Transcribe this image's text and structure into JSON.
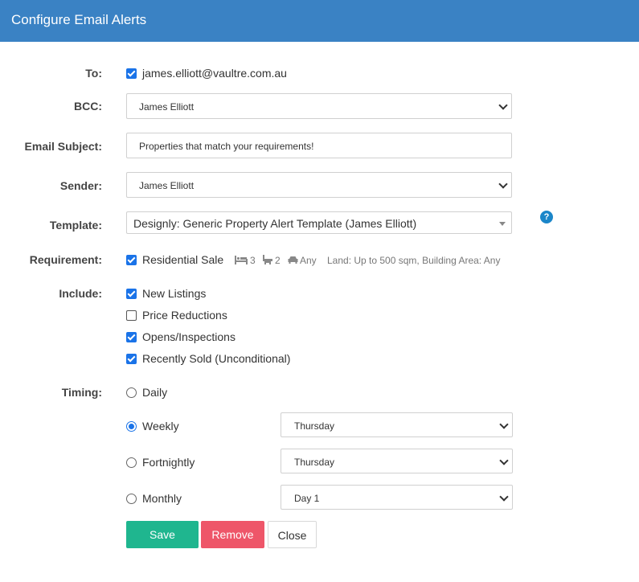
{
  "dialog": {
    "title": "Configure Email Alerts"
  },
  "form": {
    "to": {
      "label": "To:",
      "email": "james.elliott@vaultre.com.au",
      "checked": true
    },
    "bcc": {
      "label": "BCC:",
      "value": "James Elliott"
    },
    "subject": {
      "label": "Email Subject:",
      "value": "Properties that match your requirements!"
    },
    "sender": {
      "label": "Sender:",
      "value": "James Elliott"
    },
    "template": {
      "label": "Template:",
      "value": "Designly: Generic Property Alert Template (James Elliott)",
      "help": "?"
    },
    "requirement": {
      "label": "Requirement:",
      "name": "Residential Sale",
      "checked": true,
      "beds": "3",
      "baths": "2",
      "cars": "Any",
      "details": "Land: Up to 500 sqm, Building Area: Any"
    },
    "include": {
      "label": "Include:",
      "items": [
        {
          "label": "New Listings",
          "checked": true
        },
        {
          "label": "Price Reductions",
          "checked": false
        },
        {
          "label": "Opens/Inspections",
          "checked": true
        },
        {
          "label": "Recently Sold (Unconditional)",
          "checked": true
        }
      ]
    },
    "timing": {
      "label": "Timing:",
      "options": [
        {
          "label": "Daily",
          "selected": false
        },
        {
          "label": "Weekly",
          "selected": true,
          "select": "Thursday"
        },
        {
          "label": "Fortnightly",
          "selected": false,
          "select": "Thursday"
        },
        {
          "label": "Monthly",
          "selected": false,
          "select": "Day 1"
        }
      ]
    }
  },
  "actions": {
    "save": "Save",
    "remove": "Remove",
    "close": "Close"
  },
  "colors": {
    "header": "#3a82c4",
    "accent": "#1a73e8",
    "save": "#1fb68f",
    "remove": "#ee5669",
    "help": "#1b86c9"
  }
}
